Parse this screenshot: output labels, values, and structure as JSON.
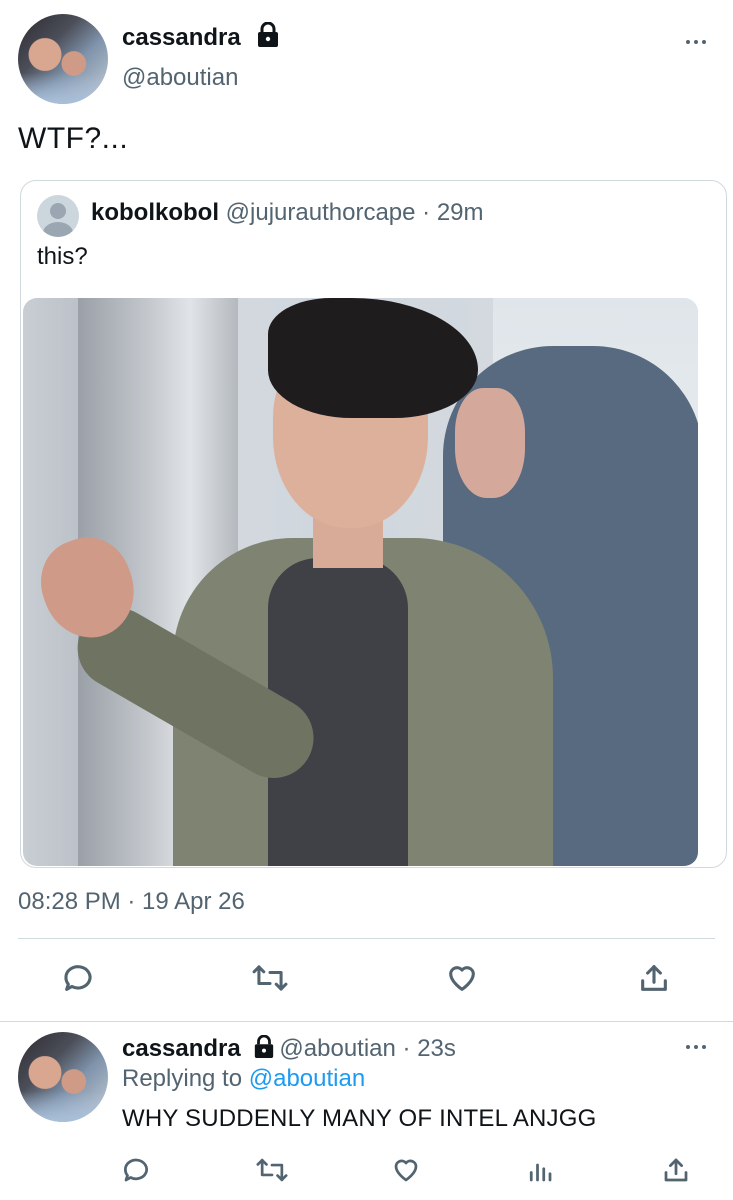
{
  "main_tweet": {
    "display_name": "cassandra",
    "handle": "@aboutian",
    "text": "WTF?...",
    "timestamp": "08:28 PM · 19 Apr 26"
  },
  "quoted_tweet": {
    "display_name": "kobolkobol",
    "handle": "@jujurauthorcape",
    "separator": " · ",
    "time": "29m",
    "text": "this?"
  },
  "actions": [
    "reply-icon",
    "retweet-icon",
    "like-icon",
    "share-icon"
  ],
  "reply_tweet": {
    "display_name": "cassandra",
    "handle": "@aboutian",
    "separator": " · ",
    "time": "23s",
    "replying_prefix": "Replying to ",
    "replying_to": "@aboutian",
    "text": "WHY SUDDENLY MANY OF INTEL ANJGG"
  },
  "reply_actions": [
    "reply-icon",
    "retweet-icon",
    "like-icon",
    "analytics-icon",
    "share-icon"
  ],
  "colors": {
    "link": "#1d9bf0",
    "muted": "#536471",
    "border": "#cfd9de"
  }
}
